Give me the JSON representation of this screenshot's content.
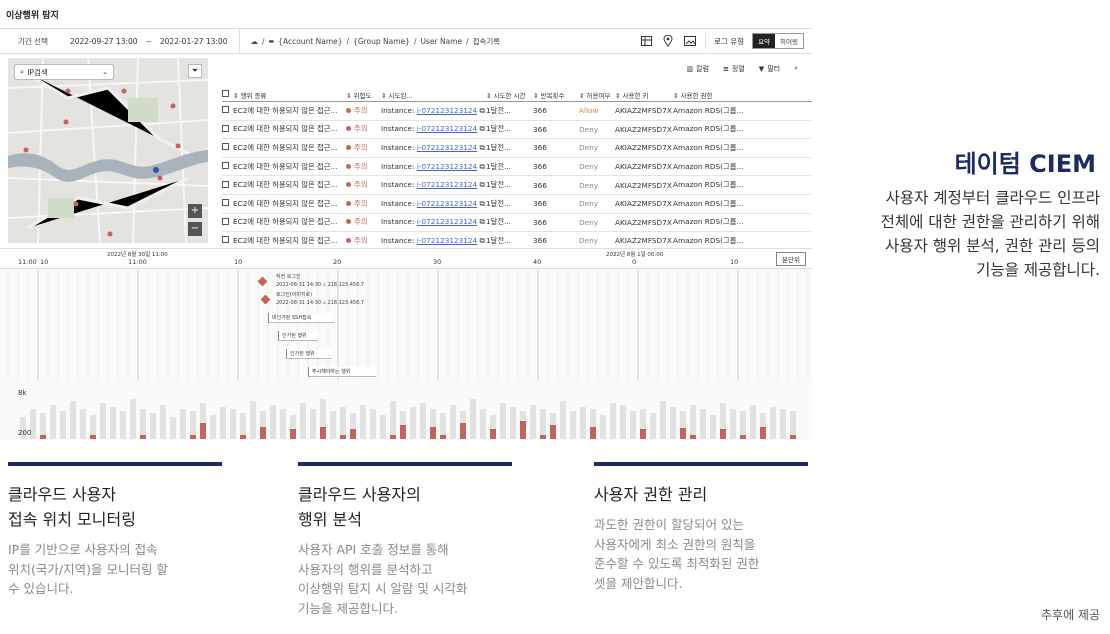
{
  "app": {
    "title": "이상행위 탐지"
  },
  "filter": {
    "period_label": "기간 선택",
    "start": "2022-09-27  13:00",
    "end": "2022-01-27  13:00",
    "breadcrumb": [
      "{Account Name}",
      "{Group Name}",
      "User Name",
      "접속기록"
    ],
    "log_type_label": "로그 유형",
    "toggle": [
      "요약",
      "히어링"
    ]
  },
  "map": {
    "ip_select": "IP검색",
    "zoom_in": "+",
    "zoom_out": "−"
  },
  "tools": {
    "column": "칼럼",
    "sort": "정렬",
    "filter": "필터"
  },
  "table": {
    "headers": [
      "행위 종류",
      "위험도",
      "시도된...",
      "시도한 시간",
      "반복횟수",
      "허용여부",
      "사용한 키",
      "사용한 권한"
    ],
    "rows": [
      {
        "action": "EC2에 대한 허용되지 않은 접근...",
        "risk": "주의",
        "instance_prefix": "Instance: ",
        "instance_id": "i-072123123124",
        "time": "1달전...",
        "count": "366",
        "allowed": "Allow",
        "key": "AKIAZ2MFSD7X",
        "perm": "Amazon RDS(그룹..."
      },
      {
        "action": "EC2에 대한 허용되지 않은 접근...",
        "risk": "주의",
        "instance_prefix": "Instance: ",
        "instance_id": "i-072123123124",
        "time": "1달전...",
        "count": "366",
        "allowed": "Deny",
        "key": "AKIAZ2MFSD7X",
        "perm": "Amazon RDS(그룹..."
      },
      {
        "action": "EC2에 대한 허용되지 않은 접근...",
        "risk": "주의",
        "instance_prefix": "Instance: ",
        "instance_id": "i-072123123124",
        "time": "1달전...",
        "count": "366",
        "allowed": "Deny",
        "key": "AKIAZ2MFSD7X",
        "perm": "Amazon RDS(그룹..."
      },
      {
        "action": "EC2에 대한 허용되지 않은 접근...",
        "risk": "주의",
        "instance_prefix": "Instance: ",
        "instance_id": "i-072123123124",
        "time": "1달전...",
        "count": "366",
        "allowed": "Deny",
        "key": "AKIAZ2MFSD7X",
        "perm": "Amazon RDS(그룹..."
      },
      {
        "action": "EC2에 대한 허용되지 않은 접근...",
        "risk": "주의",
        "instance_prefix": "Instance: ",
        "instance_id": "i-072123123124",
        "time": "1달전...",
        "count": "366",
        "allowed": "Deny",
        "key": "AKIAZ2MFSD7X",
        "perm": "Amazon RDS(그룹..."
      },
      {
        "action": "EC2에 대한 허용되지 않은 접근...",
        "risk": "주의",
        "instance_prefix": "Instance: ",
        "instance_id": "i-072123123124",
        "time": "1달전...",
        "count": "366",
        "allowed": "Deny",
        "key": "AKIAZ2MFSD7X",
        "perm": "Amazon RDS(그룹..."
      },
      {
        "action": "EC2에 대한 허용되지 않은 접근...",
        "risk": "주의",
        "instance_prefix": "Instance: ",
        "instance_id": "i-072123123124",
        "time": "1달전...",
        "count": "366",
        "allowed": "Deny",
        "key": "AKIAZ2MFSD7X",
        "perm": "Amazon RDS(그룹..."
      },
      {
        "action": "EC2에 대한 허용되지 않은 접근...",
        "risk": "주의",
        "instance_prefix": "Instance: ",
        "instance_id": "i-072123123124",
        "time": "1달전...",
        "count": "366",
        "allowed": "Deny",
        "key": "AKIAZ2MFSD7X",
        "perm": "Amazon RDS(그룹..."
      }
    ]
  },
  "timeline": {
    "date_left": "2022년 8월 30일 11:00",
    "date_right": "2022년 8월 1일 00:00",
    "ticks": [
      "11:00",
      "10",
      "11:00",
      "10",
      "20",
      "30",
      "40",
      "0",
      "10"
    ],
    "unit_button": "분단위",
    "events": [
      {
        "title": "작전 로그인",
        "time": "2022-08-31 14:30",
        "ip": "218.123.456.7"
      },
      {
        "title": "로그인(이미지로)",
        "time": "2022-08-31 14:30",
        "ip": "218.123.456.7"
      }
    ],
    "labels": [
      "비인가된 SSH접속",
      "인가된 행위",
      "인가된 행위",
      "주시해야하는 행위"
    ],
    "y_top": "8k",
    "y_bottom": "200"
  },
  "colors": {
    "accent": "#c0675d",
    "navy": "#1f2b5e"
  },
  "marketing": {
    "title": "테이텀 CIEM",
    "desc_lines": [
      "사용자 계정부터 클라우드 인프라",
      "전체에 대한 권한을 관리하기 위해",
      "사용자 행위 분석, 권한 관리 등의",
      "기능을 제공합니다."
    ]
  },
  "features": [
    {
      "title": "클라우드 사용자\n접속 위치 모니터링",
      "desc": "IP를 기반으로 사용자의 접속\n위치(국가/지역)을 모니터링 할\n수 있습니다."
    },
    {
      "title": "클라우드 사용자의\n 행위 분석",
      "desc": "사용자 API 호출 정보를 통해\n사용자의 행위를 분석하고\n이상행위 탐지 시 알람 및 시각화\n기능을 제공합니다."
    },
    {
      "title": "사용자 권한 관리",
      "desc": "과도한 권한이 할당되어 있는\n사용자에게 최소 권한의 원칙을\n준수할 수 있도록 최적화된 권한\n셋을 제안합니다."
    }
  ],
  "footnote": "추후에 제공"
}
